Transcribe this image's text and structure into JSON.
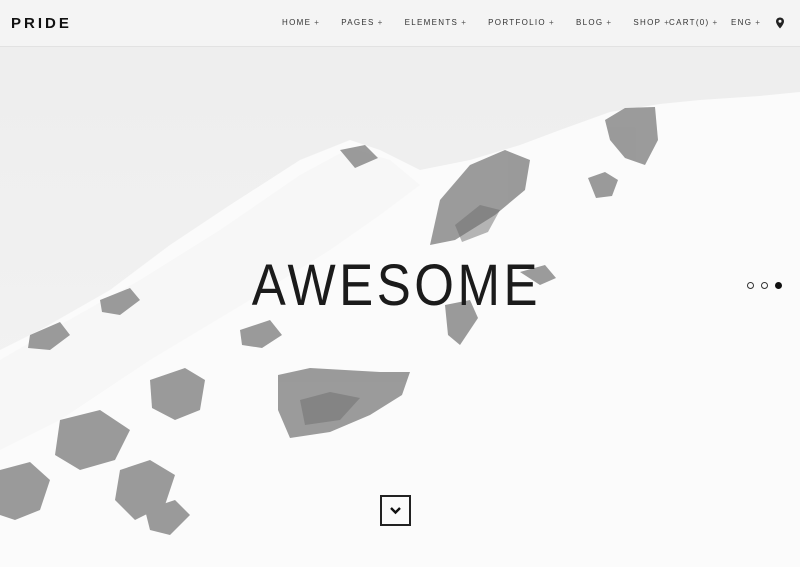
{
  "brand": {
    "logo_text": "PRIDE"
  },
  "nav": {
    "items": [
      {
        "label": "HOME",
        "suffix": "+"
      },
      {
        "label": "PAGES",
        "suffix": "+"
      },
      {
        "label": "ELEMENTS",
        "suffix": "+"
      },
      {
        "label": "PORTFOLIO",
        "suffix": "+"
      },
      {
        "label": "BLOG",
        "suffix": "+"
      },
      {
        "label": "SHOP",
        "suffix": "+"
      }
    ]
  },
  "utility": {
    "cart_label": "CART(0)",
    "cart_suffix": "+",
    "lang_label": "ENG",
    "lang_suffix": "+",
    "location_icon": "map-pin-icon"
  },
  "hero": {
    "headline": "AWESOME",
    "slides_total": 3,
    "active_slide": 3,
    "scroll_icon": "chevron-down-icon"
  },
  "colors": {
    "text": "#1b1b1b",
    "header_bg": "#f4f4f4",
    "rock": "#7d7d7d"
  }
}
